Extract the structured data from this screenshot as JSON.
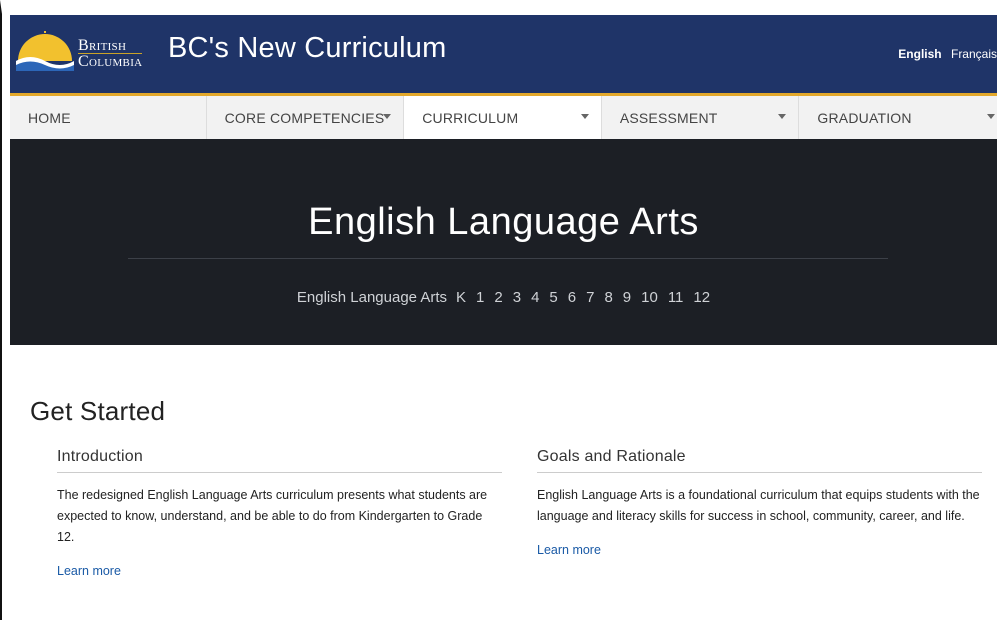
{
  "header": {
    "logo_line1": "British",
    "logo_line2": "Columbia",
    "site_title": "BC's New Curriculum",
    "lang_english": "English",
    "lang_french": "Français",
    "bg_color": "#1f3468"
  },
  "nav": {
    "items": [
      {
        "label": "HOME",
        "dropdown": false
      },
      {
        "label": "CORE COMPETENCIES",
        "dropdown": true
      },
      {
        "label": "CURRICULUM",
        "dropdown": true
      },
      {
        "label": "ASSESSMENT",
        "dropdown": true
      },
      {
        "label": "GRADUATION",
        "dropdown": true
      }
    ],
    "active_index": 2,
    "accent_color": "#e3a82b"
  },
  "hero": {
    "title": "English Language Arts",
    "crumb": "English Language Arts",
    "grades": [
      "K",
      "1",
      "2",
      "3",
      "4",
      "5",
      "6",
      "7",
      "8",
      "9",
      "10",
      "11",
      "12"
    ]
  },
  "main": {
    "heading": "Get Started",
    "intro": {
      "title": "Introduction",
      "body": "The redesigned English Language Arts curriculum presents what students are expected to know, understand, and be able to do from Kindergarten to Grade 12.",
      "link": "Learn more"
    },
    "goals": {
      "title": "Goals and Rationale",
      "body": "English Language Arts is a foundational curriculum that equips students with the language and literacy skills for success in school, community, career, and life.",
      "link": "Learn more"
    }
  }
}
